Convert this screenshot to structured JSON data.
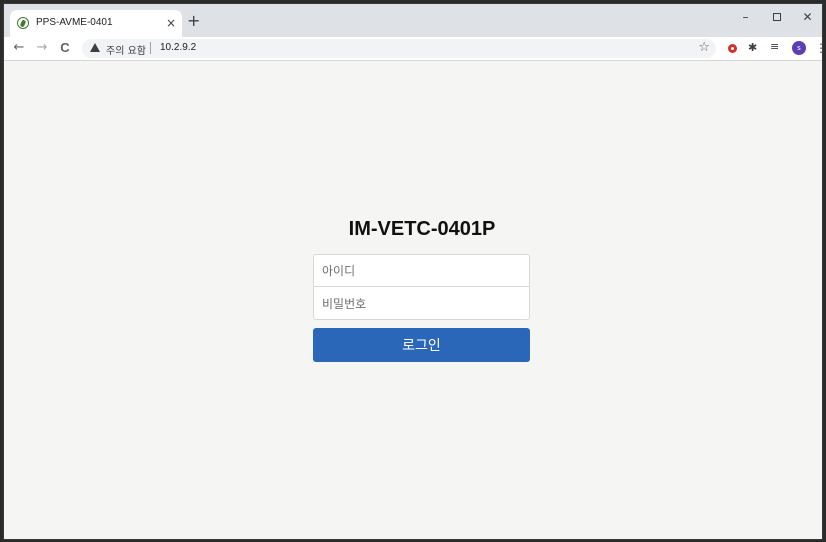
{
  "browser": {
    "tab": {
      "title": "PPS-AVME-0401",
      "close": "×",
      "favicon": "leaf-icon"
    },
    "new_tab": "+",
    "window": {
      "minimize": "–",
      "close": "✕"
    },
    "nav": {
      "back": "←",
      "forward": "→",
      "reload": "C"
    },
    "omnibox": {
      "security_label": "주의 요함",
      "url": "10.2.9.2"
    },
    "bookmark": "☆",
    "extensions": {
      "puzzle": "✱",
      "queue": "≡",
      "menu": "⋮"
    },
    "profile": {
      "initial": "s"
    }
  },
  "page": {
    "title": "IM-VETC-0401P",
    "id_placeholder": "아이디",
    "password_placeholder": "비밀번호",
    "login_label": "로그인"
  },
  "colors": {
    "login_button": "#2a67b8",
    "page_background": "#f5f5f4",
    "tabstrip": "#dee1e6"
  }
}
